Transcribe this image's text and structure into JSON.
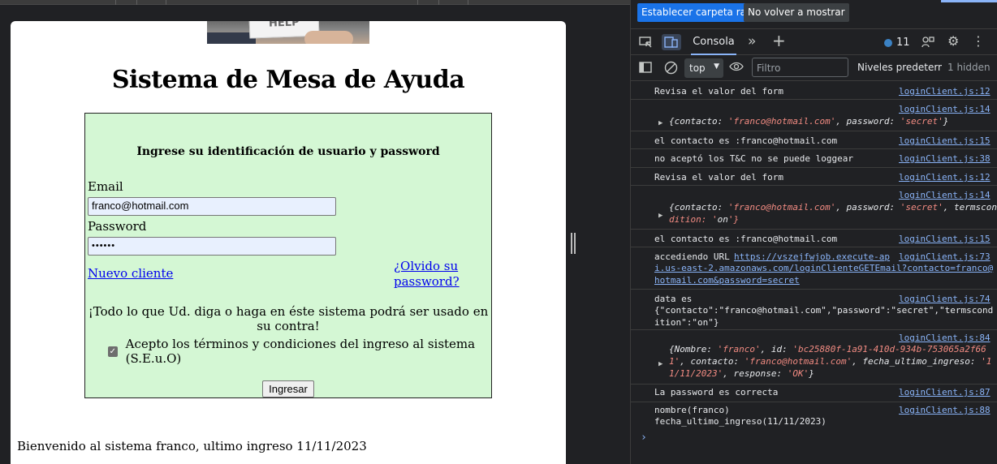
{
  "page": {
    "hero_sign_text": "HELP",
    "title": "Sistema de Mesa de Ayuda",
    "form_heading": "Ingrese su identificación de usuario y password",
    "email_label": "Email",
    "email_value": "franco@hotmail.com",
    "password_label": "Password",
    "password_value": "••••••",
    "new_client_link": "Nuevo cliente",
    "forgot_line1": "¿Olvido su",
    "forgot_line2": "password?",
    "warning": "¡Todo lo que Ud. diga o haga en éste sistema podrá ser usado en su contra!",
    "terms_label": "Acepto los términos y condiciones del ingreso al sistema (S.E.u.O)",
    "terms_checked": true,
    "submit_label": "Ingresar",
    "welcome": "Bienvenido al sistema franco, ultimo ingreso 11/11/2023"
  },
  "devtools": {
    "infobar": {
      "primary": "Establecer carpeta raíz",
      "secondary": "No volver a mostrar"
    },
    "tabs": {
      "console": "Consola"
    },
    "issues_count": "11",
    "toolbar": {
      "context": "top",
      "filter_placeholder": "Filtro",
      "levels": "Niveles predeterminados",
      "hidden": "1 hidden"
    },
    "messages": [
      {
        "text": "Revisa el valor del form",
        "source": "loginClient.js:12"
      },
      {
        "source": "loginClient.js:14",
        "object": "{contacto: 'franco@hotmail.com', password: 'secret'}"
      },
      {
        "text": "el contacto es :franco@hotmail.com",
        "source": "loginClient.js:15"
      },
      {
        "text": "no aceptó los T&C no se puede loggear",
        "source": "loginClient.js:38"
      },
      {
        "text": "Revisa el valor del form",
        "source": "loginClient.js:12"
      },
      {
        "source": "loginClient.js:14",
        "object_line1": "{contacto: 'franco@hotmail.com', password: 'secret', termscon",
        "object_line2": "dition: 'on'}"
      },
      {
        "text": "el contacto es :franco@hotmail.com",
        "source": "loginClient.js:15"
      },
      {
        "text": "accediendo URL",
        "source": "loginClient.js:73",
        "url_line1": "https://vszejfwjob.execute-ap",
        "url_line2": "i.us-east-2.amazonaws.com/loginClienteGETEmail?contacto=franco@",
        "url_line3": "hotmail.com&password=secret"
      },
      {
        "text": "data es",
        "source": "loginClient.js:74",
        "line2": "{\"contacto\":\"franco@hotmail.com\",\"password\":\"secret\",\"termscond",
        "line3": "ition\":\"on\"}"
      },
      {
        "source": "loginClient.js:84",
        "object_line1": "{Nombre: 'franco', id: 'bc25880f-1a91-410d-934b-753065a2f66",
        "object_line2": "1', contacto: 'franco@hotmail.com', fecha_ultimo_ingreso: '1",
        "object_line3": "1/11/2023', response: 'OK'}"
      },
      {
        "text": "La password es correcta",
        "source": "loginClient.js:87"
      },
      {
        "text": "nombre(franco)",
        "source": "loginClient.js:88",
        "line2": "fecha_ultimo_ingreso(11/11/2023)"
      }
    ],
    "prompt": "›"
  }
}
